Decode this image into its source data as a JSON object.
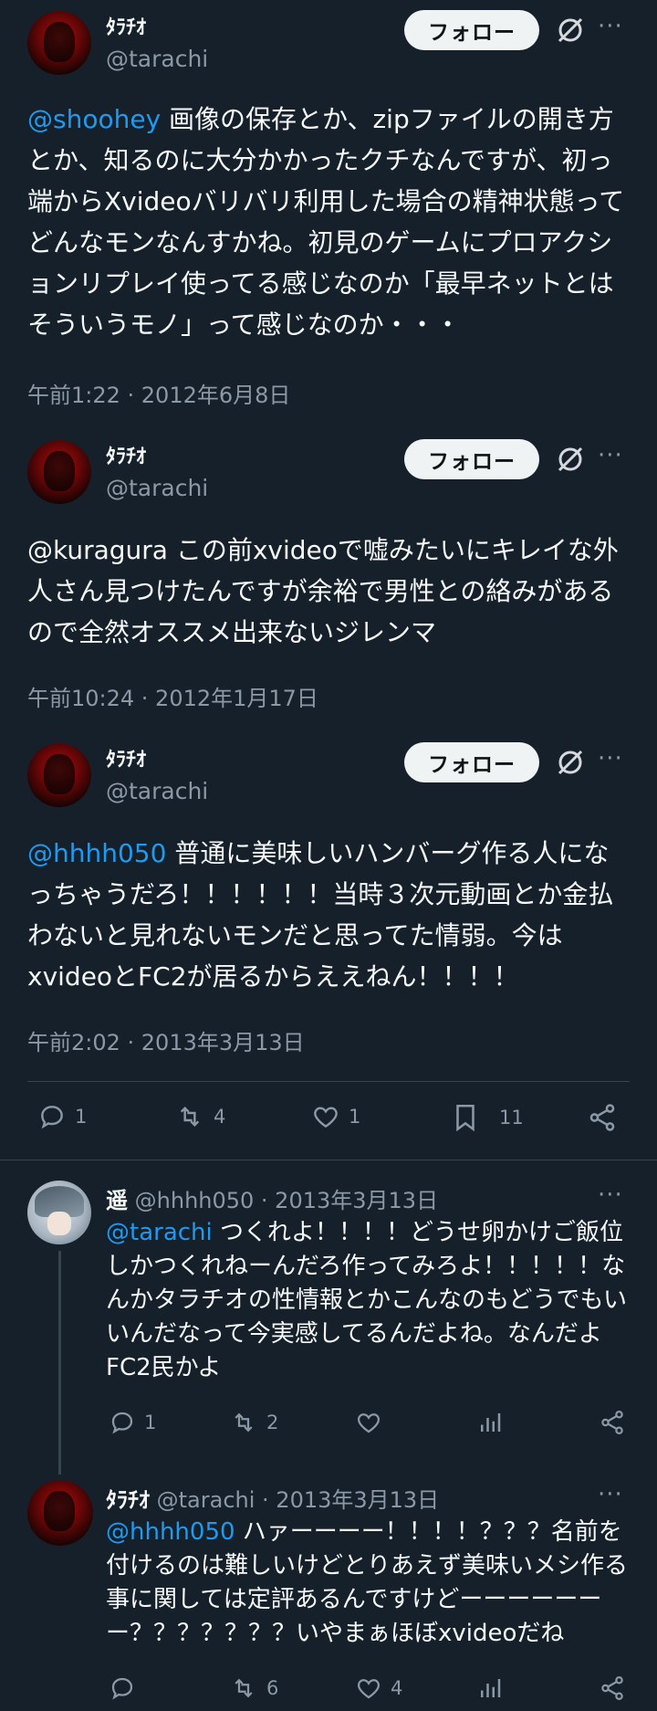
{
  "tweets": [
    {
      "name": "ﾀﾗﾁｵ",
      "handle": "@tarachi",
      "follow_label": "フォロー",
      "mention": "@shoohey",
      "text": " 画像の保存とか、zipファイルの開き方とか、知るのに大分かかったクチなんですが、初っ端からXvideoバリバリ利用した場合の精神状態ってどんなモンなんすかね。初見のゲームにプロアクションリプレイ使ってる感じなのか「最早ネットとはそういうモノ」って感じなのか・・・",
      "timestamp": "午前1:22 · 2012年6月8日"
    },
    {
      "name": "ﾀﾗﾁｵ",
      "handle": "@tarachi",
      "follow_label": "フォロー",
      "mention": "",
      "text": "@kuragura この前xvideoで嘘みたいにキレイな外人さん見つけたんですが余裕で男性との絡みがあるので全然オススメ出来ないジレンマ",
      "timestamp": "午前10:24 · 2012年1月17日"
    },
    {
      "name": "ﾀﾗﾁｵ",
      "handle": "@tarachi",
      "follow_label": "フォロー",
      "mention": "@hhhh050",
      "text": " 普通に美味しいハンバーグ作る人になっちゃうだろ！！！！！！当時３次元動画とか金払わないと見れないモンだと思ってた情弱。今はxvideoとFC2が居るからええねん！！！！",
      "timestamp": "午前2:02 · 2013年3月13日",
      "actions": {
        "replies": "1",
        "retweets": "4",
        "likes": "1",
        "bookmarks": "11"
      }
    }
  ],
  "replies": [
    {
      "name": "遥",
      "handle": "@hhhh050 · 2013年3月13日",
      "mention": "@tarachi",
      "text": " つくれよ！！！！どうせ卵かけご飯位しかつくれねーんだろ作ってみろよ！！！！！なんかタラチオの性情報とかこんなのもどうでもいいんだなって今実感してるんだよね。なんだよFC2民かよ",
      "actions": {
        "replies": "1",
        "retweets": "2",
        "likes": ""
      }
    },
    {
      "name": "ﾀﾗﾁｵ",
      "handle": "@tarachi · 2013年3月13日",
      "mention": "@hhhh050",
      "text": " ハァーーーー！！！！？？？名前を付けるのは難しいけどとりあえず美味いメシ作る事に関しては定評あるんですけどーーーーーーー？？？？？？？いやまぁほぼxvideoだね",
      "actions": {
        "replies": "",
        "retweets": "6",
        "likes": "4"
      }
    }
  ],
  "more_label": "···"
}
